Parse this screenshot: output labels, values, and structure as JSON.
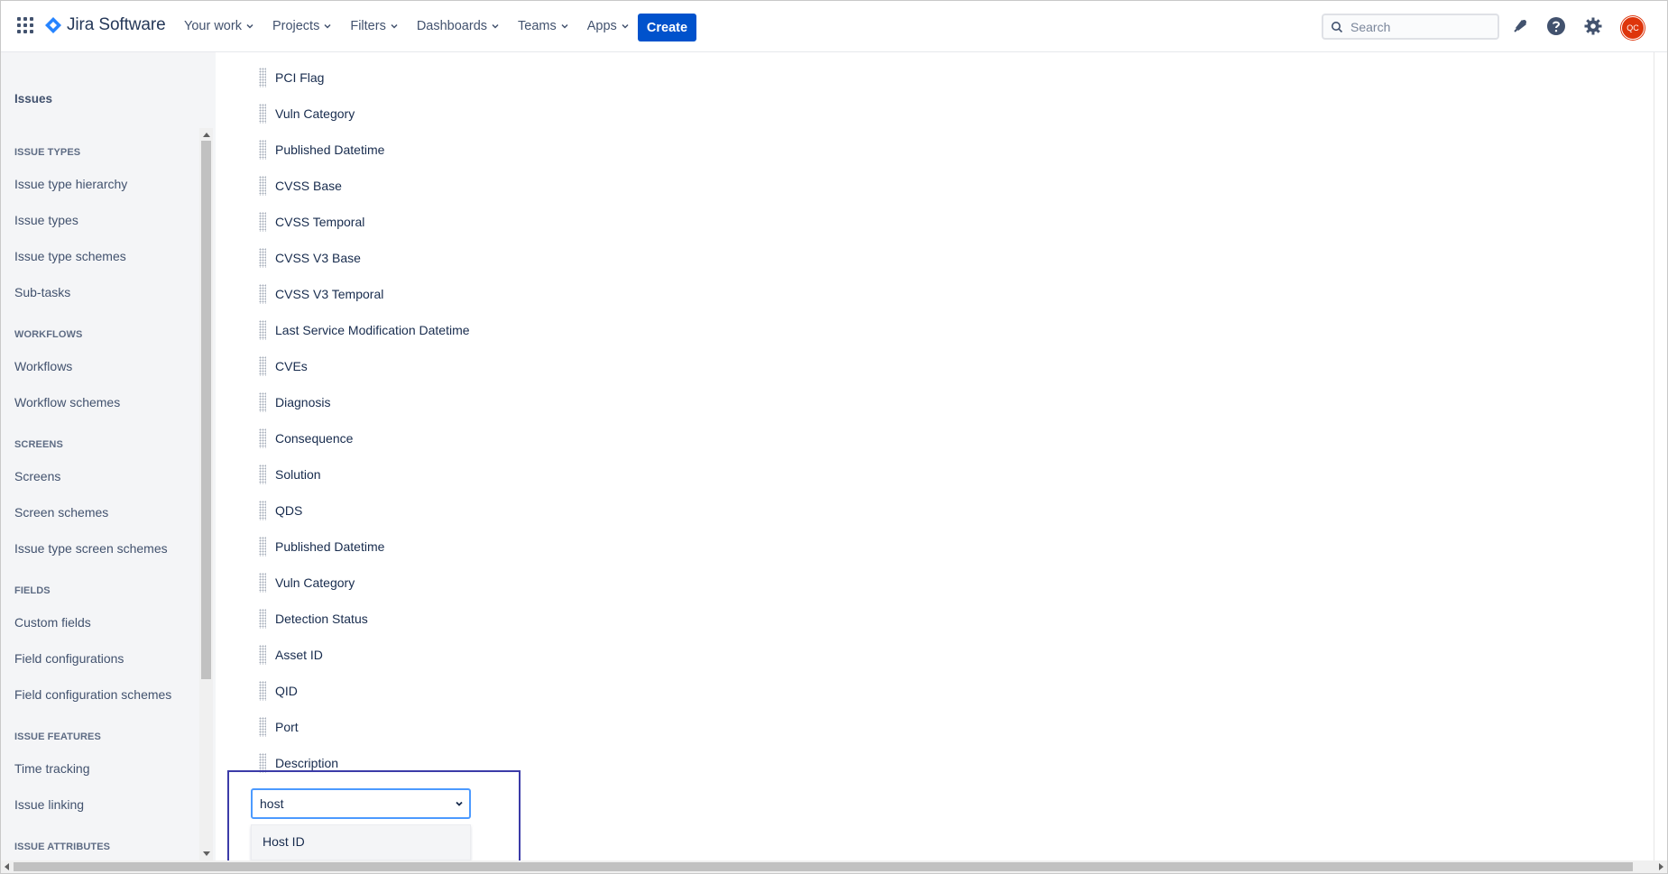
{
  "app": {
    "name": "Jira Software",
    "brand_color": "#0052cc"
  },
  "topnav": {
    "items": [
      {
        "label": "Your work"
      },
      {
        "label": "Projects"
      },
      {
        "label": "Filters"
      },
      {
        "label": "Dashboards"
      },
      {
        "label": "Teams"
      },
      {
        "label": "Apps"
      }
    ],
    "create_label": "Create",
    "search_placeholder": "Search",
    "avatar_initials": "QC",
    "icons": [
      "app-switcher-icon",
      "notifications-icon",
      "help-icon",
      "settings-icon"
    ]
  },
  "sidebar": {
    "title": "Issues",
    "sections": [
      {
        "heading": "ISSUE TYPES",
        "items": [
          "Issue type hierarchy",
          "Issue types",
          "Issue type schemes",
          "Sub-tasks"
        ]
      },
      {
        "heading": "WORKFLOWS",
        "items": [
          "Workflows",
          "Workflow schemes"
        ]
      },
      {
        "heading": "SCREENS",
        "items": [
          "Screens",
          "Screen schemes",
          "Issue type screen schemes"
        ]
      },
      {
        "heading": "FIELDS",
        "items": [
          "Custom fields",
          "Field configurations",
          "Field configuration schemes"
        ]
      },
      {
        "heading": "ISSUE FEATURES",
        "items": [
          "Time tracking",
          "Issue linking"
        ]
      },
      {
        "heading": "ISSUE ATTRIBUTES",
        "items": []
      }
    ]
  },
  "fields": [
    "PCI Flag",
    "Vuln Category",
    "Published Datetime",
    "CVSS Base",
    "CVSS Temporal",
    "CVSS V3 Base",
    "CVSS V3 Temporal",
    "Last Service Modification Datetime",
    "CVEs",
    "Diagnosis",
    "Consequence",
    "Solution",
    "QDS",
    "Published Datetime",
    "Vuln Category",
    "Detection Status",
    "Asset ID",
    "QID",
    "Port",
    "Description"
  ],
  "field_picker": {
    "value": "host",
    "options": [
      "Host ID"
    ]
  }
}
